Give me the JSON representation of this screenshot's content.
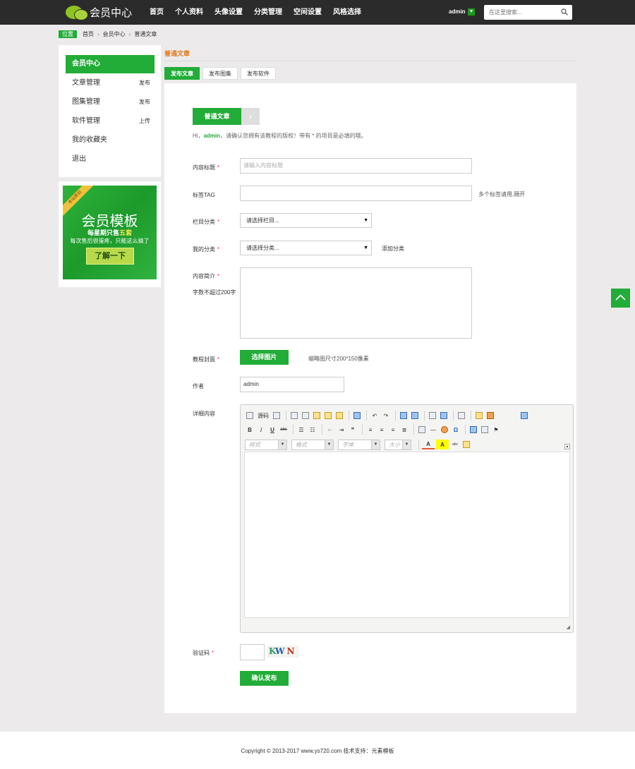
{
  "header": {
    "logo_text": "会员中心",
    "nav": [
      "首页",
      "个人资料",
      "头像设置",
      "分类管理",
      "空间设置",
      "风格选择"
    ],
    "user": "admin",
    "search_placeholder": "在这里搜索..."
  },
  "breadcrumb": {
    "tag": "位置",
    "items": [
      "首页",
      "会员中心",
      "普通文章"
    ],
    "separator": "›"
  },
  "sidebar": {
    "items": [
      {
        "label": "会员中心",
        "extra": ""
      },
      {
        "label": "文章管理",
        "extra": "发布"
      },
      {
        "label": "图集管理",
        "extra": "发布"
      },
      {
        "label": "软件管理",
        "extra": "上传"
      },
      {
        "label": "我的收藏夹",
        "extra": ""
      },
      {
        "label": "退出",
        "extra": ""
      }
    ]
  },
  "promo": {
    "ribbon": "本站原创",
    "title": "会员模板",
    "line1_pre": "每星期只售",
    "line1_hl": "五套",
    "line2": "每次售后很蛋疼，只能这么搞了",
    "button": "了解一下"
  },
  "section": {
    "title": "普通文章",
    "tabs": [
      "发布文章",
      "发布图集",
      "发布软件"
    ]
  },
  "form": {
    "step_label": "普通文章",
    "step_next": "›",
    "hint_pre": "Hi，",
    "hint_name": "admin",
    "hint_post": "，请确认您拥有该教程的版权！带有 * 的项目是必填的哦。",
    "required_mark": "*",
    "title_label": "内容标题",
    "title_placeholder": "请输入内容标题",
    "tag_label": "标签TAG",
    "tag_note": "多个标签请用,隔开",
    "column_label": "栏目分类",
    "column_value": "请选择栏目...",
    "mycat_label": "我的分类",
    "mycat_value": "请选择分类...",
    "add_category": "添加分类",
    "summary_label": "内容简介",
    "summary_note": "字数不超过200字",
    "cover_label": "教程封面",
    "cover_button": "选择图片",
    "cover_note": "缩略图尺寸200*150像素",
    "author_label": "作者",
    "author_value": "admin",
    "detail_label": "详细内容",
    "captcha_label": "验证码",
    "captcha_chars": [
      "K",
      "W",
      "N"
    ],
    "submit": "确认发布"
  },
  "editor": {
    "source_label": "源码",
    "style_combos": [
      "样式",
      "格式",
      "字体",
      "大小"
    ],
    "bold": "B",
    "italic": "I",
    "underline": "U",
    "strike": "abc"
  },
  "colors": {
    "accent": "#22ac38",
    "title_orange": "#e27a1d",
    "header_bg": "#2b2b2b"
  },
  "footer": {
    "text": "Copyright © 2013-2017 www.ys720.com 技术支持：元素模板"
  }
}
